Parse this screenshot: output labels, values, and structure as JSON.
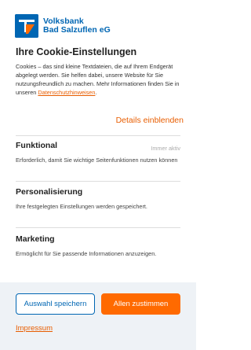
{
  "brand": {
    "line1": "Volksbank",
    "line2": "Bad Salzuflen eG",
    "color": "#0066b3"
  },
  "title": "Ihre Cookie-Einstellungen",
  "intro": {
    "text": "Cookies – das sind kleine Textdateien, die auf Ihrem Endgerät abgelegt werden. Sie helfen dabei, unsere Website für Sie nutzungsfreundlich zu machen. Mehr Informationen finden Sie in unseren",
    "link": "Datenschutzhinweisen",
    "suffix": "."
  },
  "details_link": "Details einblenden",
  "sections": {
    "funktional": {
      "title": "Funktional",
      "status": "Immer aktiv",
      "desc": "Erforderlich, damit Sie wichtige Seitenfunktionen nutzen können"
    },
    "personalisierung": {
      "title": "Personalisierung",
      "desc": "Ihre festgelegten Einstellungen werden gespeichert."
    },
    "marketing": {
      "title": "Marketing",
      "desc": "Ermöglicht für Sie passende Informationen anzuzeigen."
    }
  },
  "buttons": {
    "save_selection": "Auswahl speichern",
    "accept_all": "Allen zustimmen"
  },
  "imprint": "Impressum",
  "colors": {
    "accent": "#ff6a00",
    "link": "#e85d00",
    "brand_blue": "#0066b3",
    "footer_bg": "#eef2f6"
  }
}
